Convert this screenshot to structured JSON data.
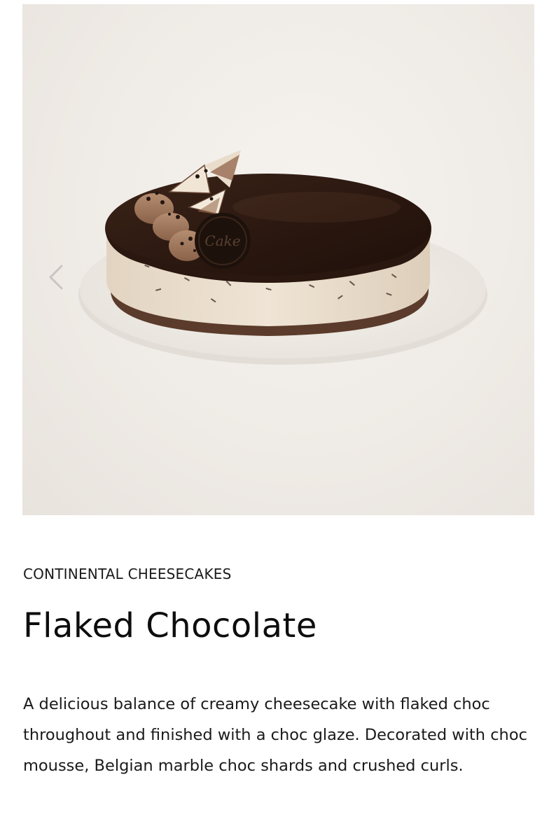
{
  "product": {
    "category": "CONTINENTAL CHEESECAKES",
    "title": "Flaked Chocolate",
    "description": "A delicious balance of creamy cheesecake with flaked choc throughout and finished with a choc glaze. Decorated with choc mousse, Belgian marble choc shards and crushed curls."
  },
  "gallery": {
    "image_subject": "flaked-chocolate-cheesecake",
    "medallion_text": "Cake",
    "prev_icon": "chevron-left-icon",
    "next_icon": "chevron-right-icon"
  },
  "colors": {
    "glaze": "#2e1a12",
    "cheesecake": "#e9dccb",
    "base": "#5a3a2a",
    "board": "#f1ede8",
    "arrow_prev": "#c9c6c2",
    "arrow_next": "#555555"
  }
}
